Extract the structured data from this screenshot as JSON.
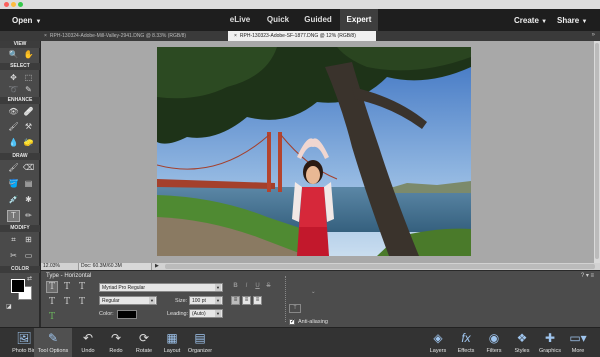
{
  "menubar": {
    "open_label": "Open",
    "modes": [
      "eLive",
      "Quick",
      "Guided",
      "Expert"
    ],
    "active_mode": "Expert",
    "create_label": "Create",
    "share_label": "Share"
  },
  "tabs": [
    {
      "label": "RPH-130324-Adobe-Mill-Valley-2941.DNG @ 8.33% (RGB/8)",
      "active": false
    },
    {
      "label": "RPH-130323-Adobe-SF-1877.DNG @ 12% (RGB/8)",
      "active": true
    }
  ],
  "toolbox": {
    "sections": [
      "VIEW",
      "SELECT",
      "ENHANCE",
      "DRAW",
      "MODIFY",
      "COLOR"
    ]
  },
  "status": {
    "zoom": "12.03%",
    "doc": "Doc: 60.3M/60.3M"
  },
  "options": {
    "title": "Type - Horizontal",
    "font_family": "Myriad Pro Regular",
    "font_style": "Regular",
    "size_label": "Size:",
    "size_value": "100 pt",
    "leading_label": "Leading:",
    "leading_value": "(Auto)",
    "color_label": "Color:",
    "antialias_label": "Anti-aliasing",
    "format_buttons": [
      "B",
      "I",
      "U",
      "S"
    ]
  },
  "bottombar": {
    "left": [
      "Photo Bin",
      "Tool Options",
      "Undo",
      "Redo",
      "Rotate",
      "Layout",
      "Organizer"
    ],
    "right": [
      "Layers",
      "Effects",
      "Filters",
      "Styles",
      "Graphics",
      "More"
    ]
  }
}
